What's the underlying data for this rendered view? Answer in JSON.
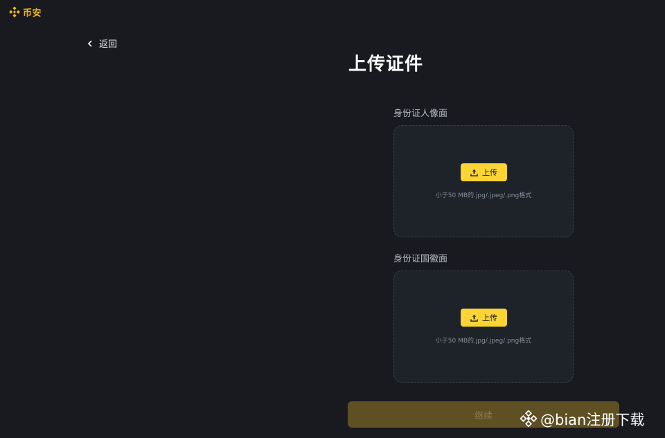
{
  "header": {
    "brand": "币安",
    "brand_color": "#f0b90b",
    "logo_icon": "binance-logo-icon"
  },
  "nav": {
    "back_label": "返回",
    "back_icon": "chevron-left-icon"
  },
  "page": {
    "title": "上传证件"
  },
  "uploads": [
    {
      "label": "身份证人像面",
      "button_label": "上传",
      "hint": "小于50 MB的.jpg/.jpeg/.png格式",
      "icon": "upload-icon"
    },
    {
      "label": "身份证国徽面",
      "button_label": "上传",
      "hint": "小于50 MB的.jpg/.jpeg/.png格式",
      "icon": "upload-icon"
    }
  ],
  "actions": {
    "continue_label": "继续"
  },
  "watermark": {
    "text": "@bian注册下载",
    "icon": "binance-logo-icon"
  },
  "colors": {
    "accent": "#fcd535",
    "background": "#181a20",
    "card": "#1e2329"
  }
}
